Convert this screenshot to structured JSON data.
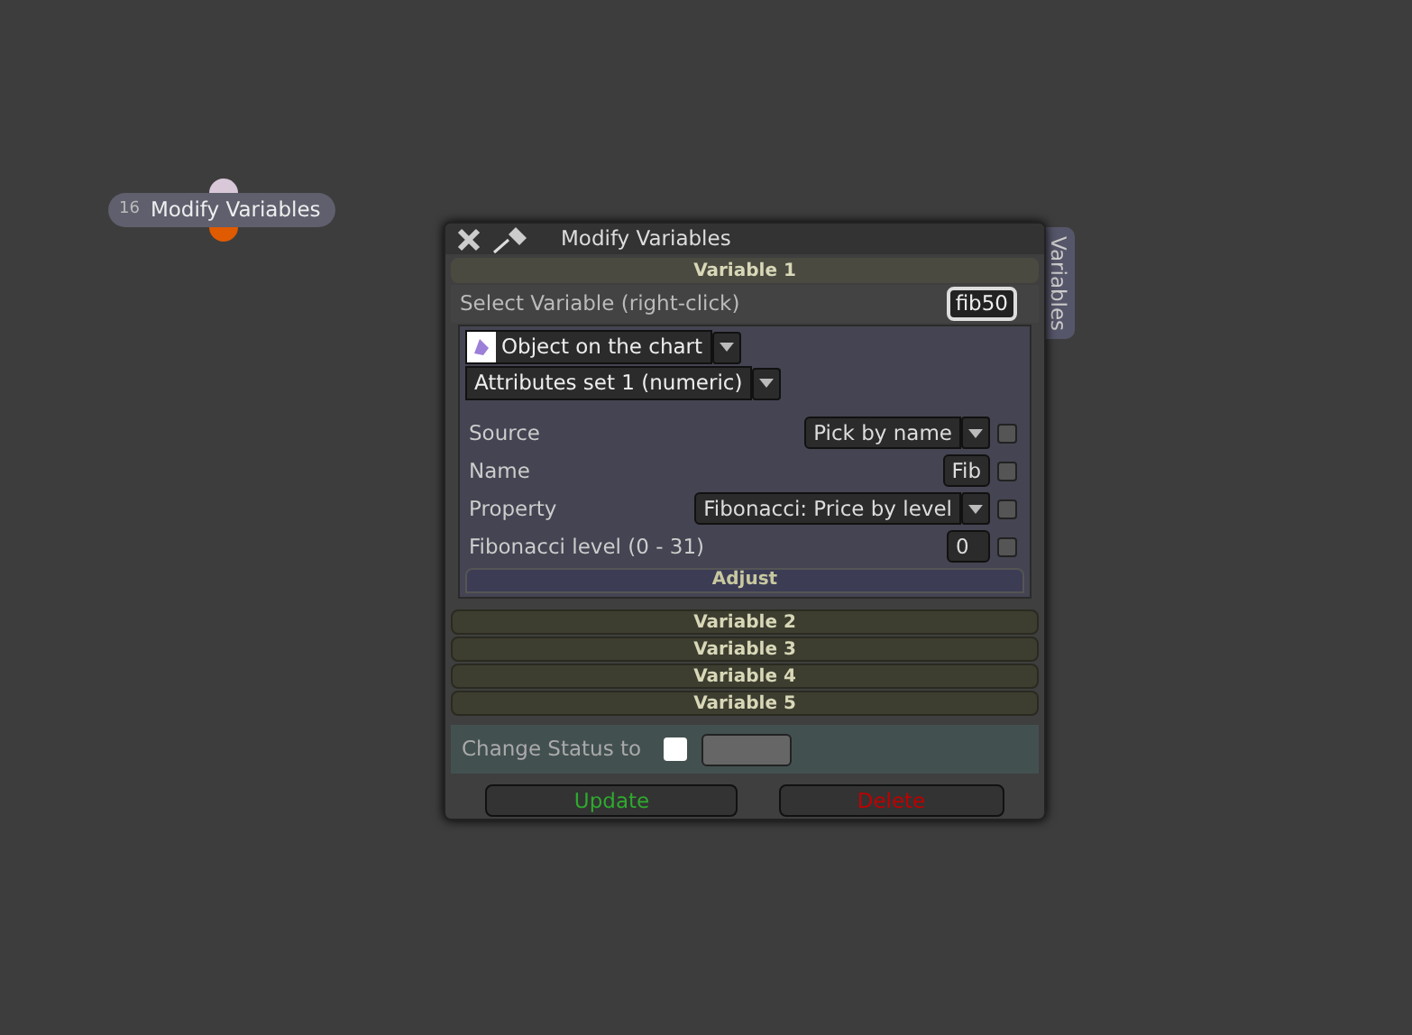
{
  "node": {
    "number": "16",
    "label": "Modify Variables"
  },
  "dialog": {
    "title": "Modify Variables",
    "side_tab": "Variables",
    "variables": [
      {
        "title": "Variable 1",
        "expanded": true,
        "select_label": "Select Variable (right-click)",
        "select_value": "fib50",
        "object_type": "Object on the chart",
        "attribute_set": "Attributes set 1 (numeric)",
        "fields": [
          {
            "kind": "dropdown",
            "label": "Source",
            "value": "Pick by name",
            "checked": false
          },
          {
            "kind": "text",
            "label": "Name",
            "value": "Fib",
            "checked": false
          },
          {
            "kind": "dropdown",
            "label": "Property",
            "value": "Fibonacci: Price by level",
            "checked": false
          },
          {
            "kind": "text",
            "label": "Fibonacci level (0 - 31)",
            "value": "0",
            "checked": false
          }
        ],
        "adjust_button": "Adjust"
      },
      {
        "title": "Variable 2",
        "expanded": false
      },
      {
        "title": "Variable 3",
        "expanded": false
      },
      {
        "title": "Variable 4",
        "expanded": false
      },
      {
        "title": "Variable 5",
        "expanded": false
      }
    ],
    "status": {
      "label": "Change Status to",
      "checked": false
    },
    "buttons": [
      {
        "kind": "update",
        "label": "Update"
      },
      {
        "kind": "delete",
        "label": "Delete"
      }
    ]
  }
}
